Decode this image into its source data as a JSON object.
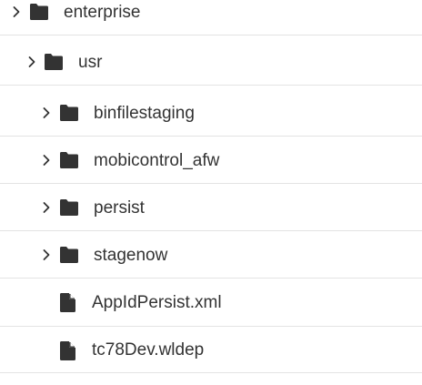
{
  "file_tree": {
    "items": [
      {
        "label": "enterprise",
        "type": "folder",
        "expandable": true,
        "icon": "folder-icon"
      },
      {
        "label": "usr",
        "type": "folder",
        "expandable": true,
        "icon": "folder-icon"
      },
      {
        "label": "binfilestaging",
        "type": "folder",
        "expandable": true,
        "icon": "folder-icon"
      },
      {
        "label": "mobicontrol_afw",
        "type": "folder",
        "expandable": true,
        "icon": "folder-icon"
      },
      {
        "label": "persist",
        "type": "folder",
        "expandable": true,
        "icon": "folder-icon"
      },
      {
        "label": "stagenow",
        "type": "folder",
        "expandable": true,
        "icon": "folder-icon"
      },
      {
        "label": "AppIdPersist.xml",
        "type": "file",
        "expandable": false,
        "icon": "file-icon"
      },
      {
        "label": "tc78Dev.wldep",
        "type": "file",
        "expandable": false,
        "icon": "file-icon"
      }
    ]
  },
  "colors": {
    "text": "#333333",
    "icon": "#333333",
    "divider": "#e3e3e3",
    "background": "#ffffff"
  }
}
